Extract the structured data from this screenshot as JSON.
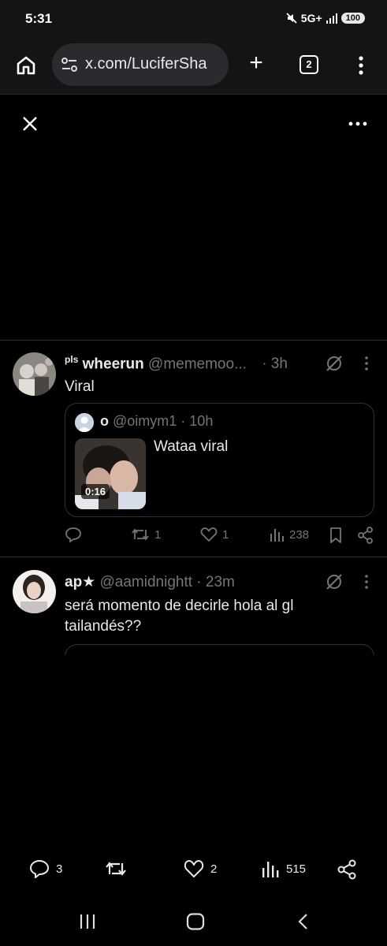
{
  "status_bar": {
    "time": "5:31",
    "network": "5G+",
    "battery": "100"
  },
  "browser": {
    "url": "x.com/LuciferSha",
    "tab_count": "2"
  },
  "tweets": [
    {
      "prefix": "pls",
      "name": "wheerun",
      "handle": "@mememoo...",
      "time": "· 3h",
      "text": "Viral",
      "quote": {
        "name": "o",
        "handle": "@oimym1 · 10h",
        "duration": "0:16",
        "text": "Wataa viral"
      },
      "actions": {
        "replies": "",
        "retweets": "1",
        "likes": "1",
        "views": "238"
      }
    },
    {
      "name": "ap★",
      "handle": "@aamidnightt · 23m",
      "text": "será momento de decirle hola al gl tailandés??"
    }
  ],
  "bottom_bar": {
    "replies": "3",
    "likes": "2",
    "views": "515"
  },
  "colors": {
    "background": "#000000",
    "text": "#e7e9ea",
    "muted": "#71767b",
    "border": "#2f3336"
  }
}
